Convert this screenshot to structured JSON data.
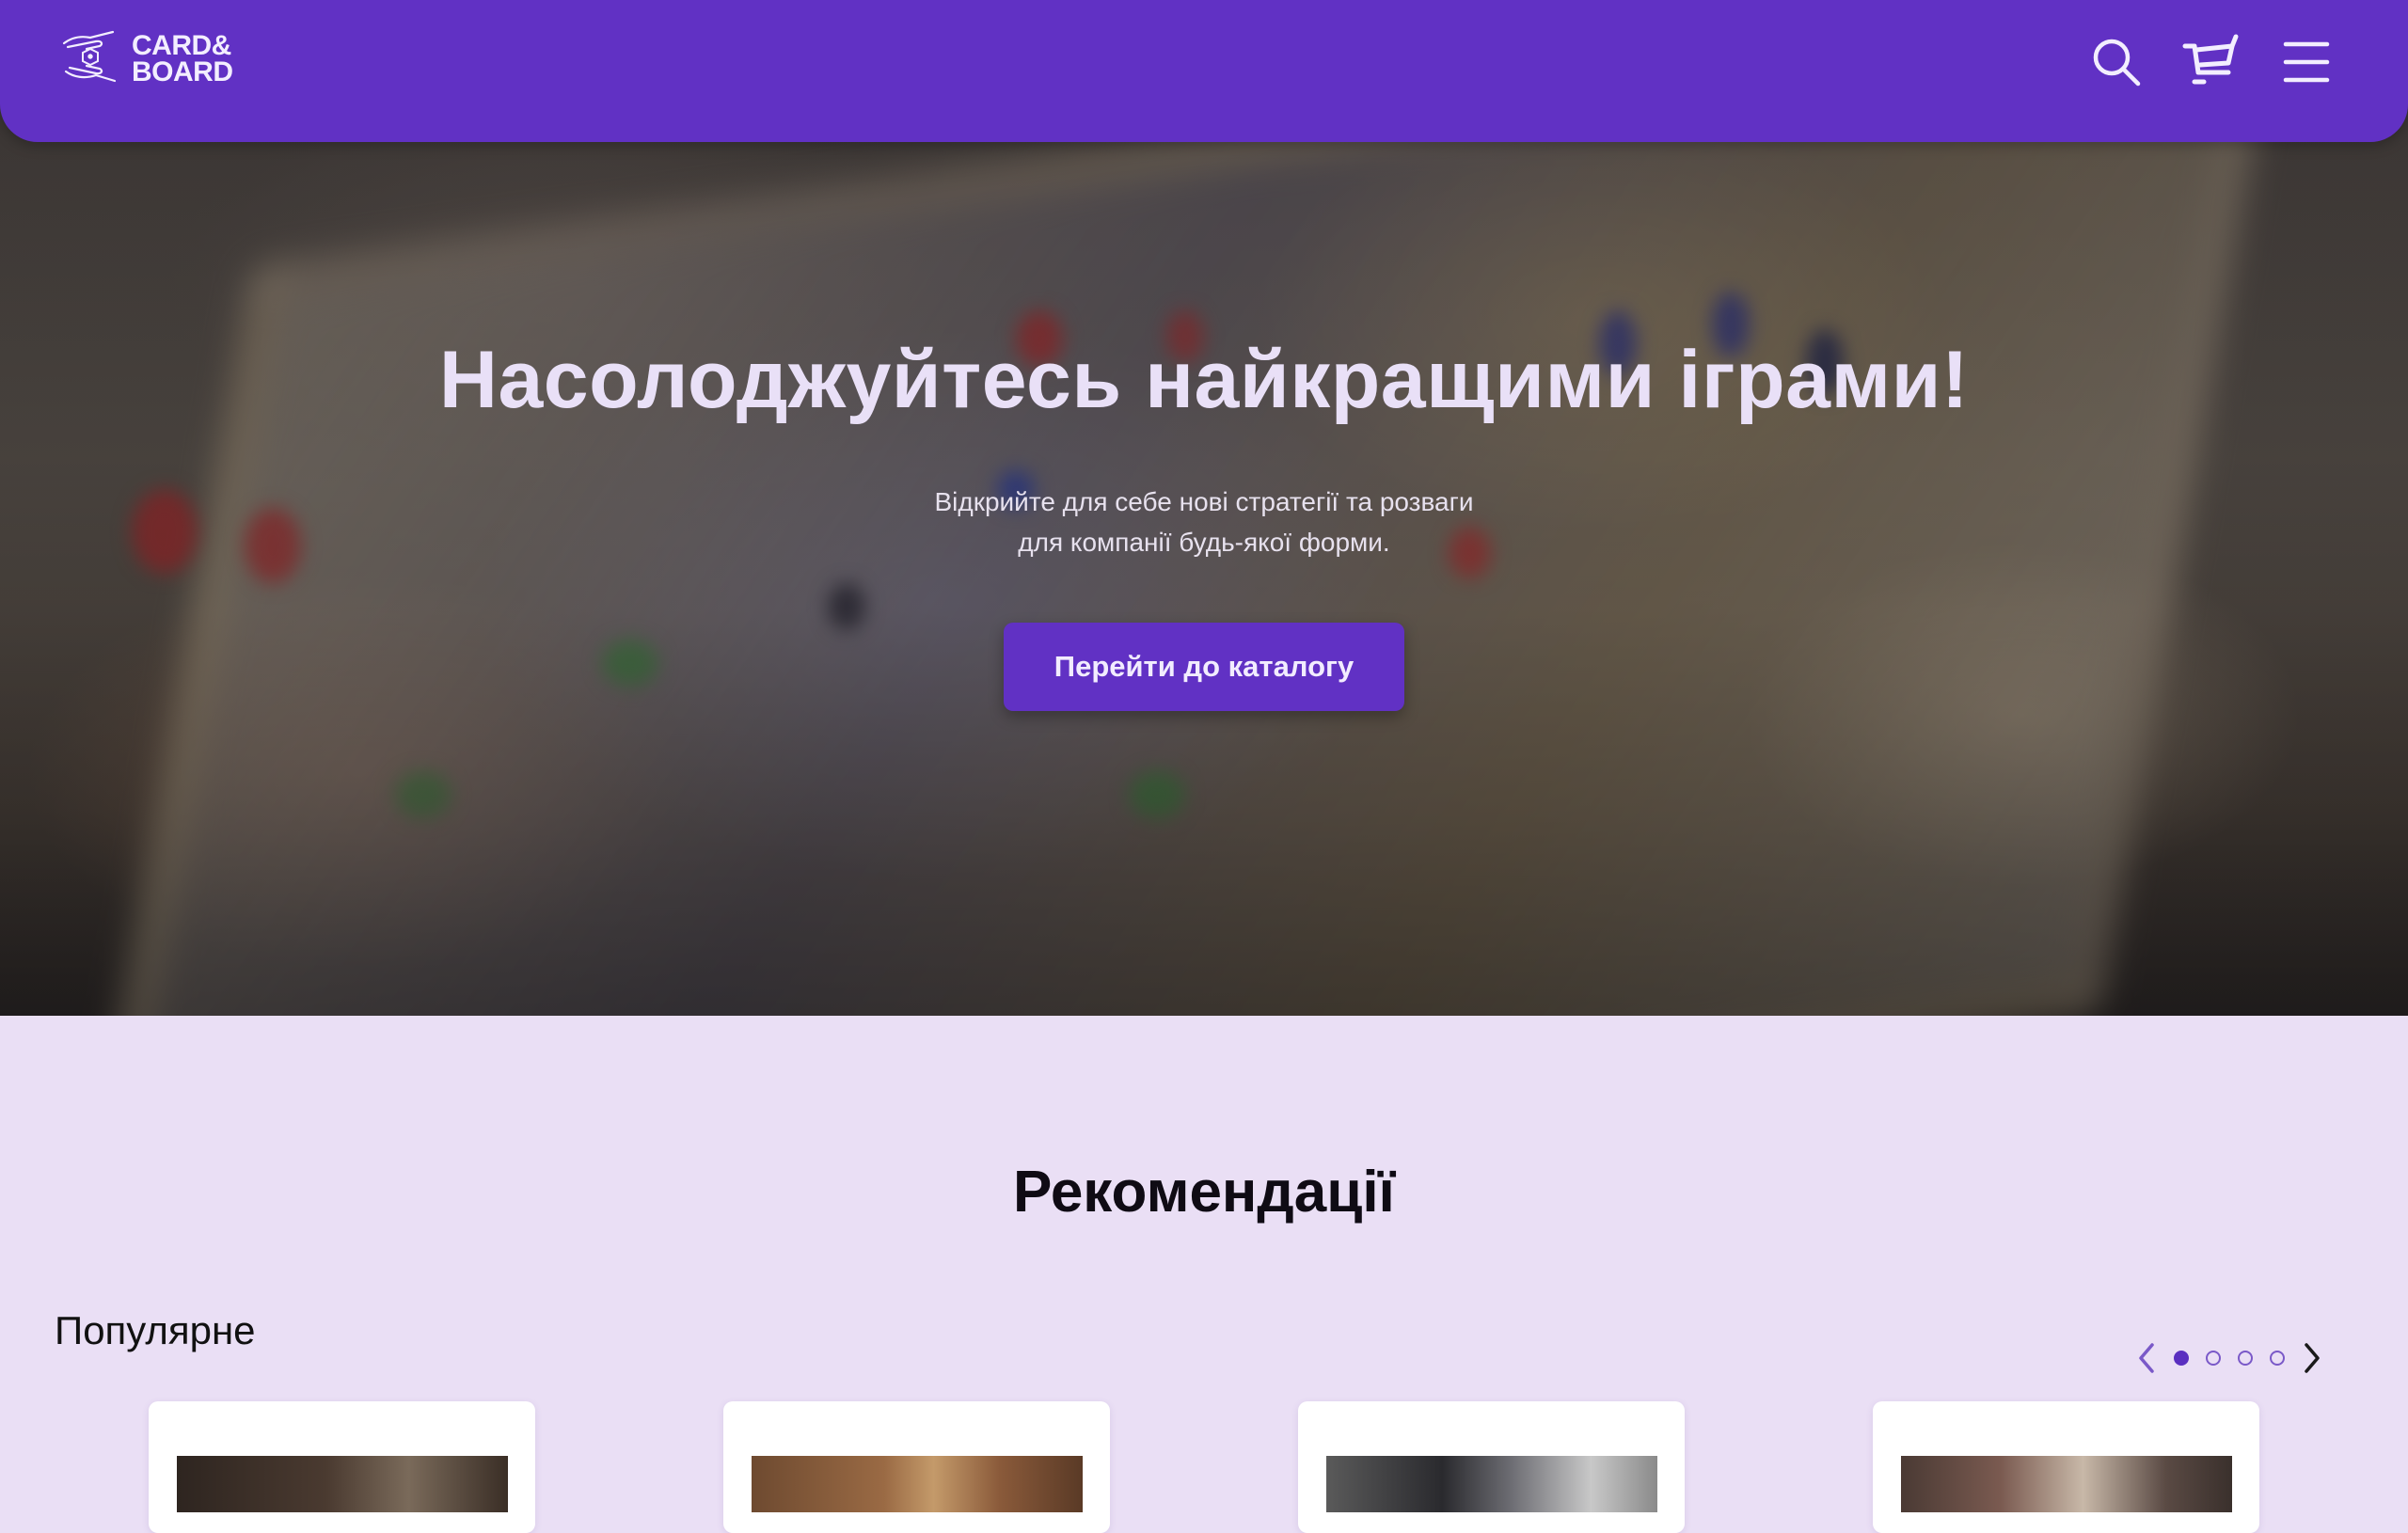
{
  "header": {
    "logo_line1": "CARD&",
    "logo_line2": "BOARD",
    "icons": [
      "search-icon",
      "cart-icon",
      "menu-icon"
    ]
  },
  "hero": {
    "title": "Насолоджуйтесь найкращими іграми!",
    "subtitle_line1": "Відкрийте для себе нові стратегії та розваги",
    "subtitle_line2": "для компанії будь-якої форми.",
    "cta_label": "Перейти до каталогу"
  },
  "recommendations": {
    "title": "Рекомендації",
    "popular_title": "Популярне",
    "carousel": {
      "pages": 4,
      "active_page": 1
    },
    "cards": [
      {
        "image": "product-photo-1"
      },
      {
        "image": "product-photo-2"
      },
      {
        "image": "product-photo-3"
      },
      {
        "image": "product-photo-4"
      }
    ]
  },
  "colors": {
    "brand": "#6131c4",
    "page_background": "#eadff5",
    "hero_title": "#e9e0f7"
  }
}
